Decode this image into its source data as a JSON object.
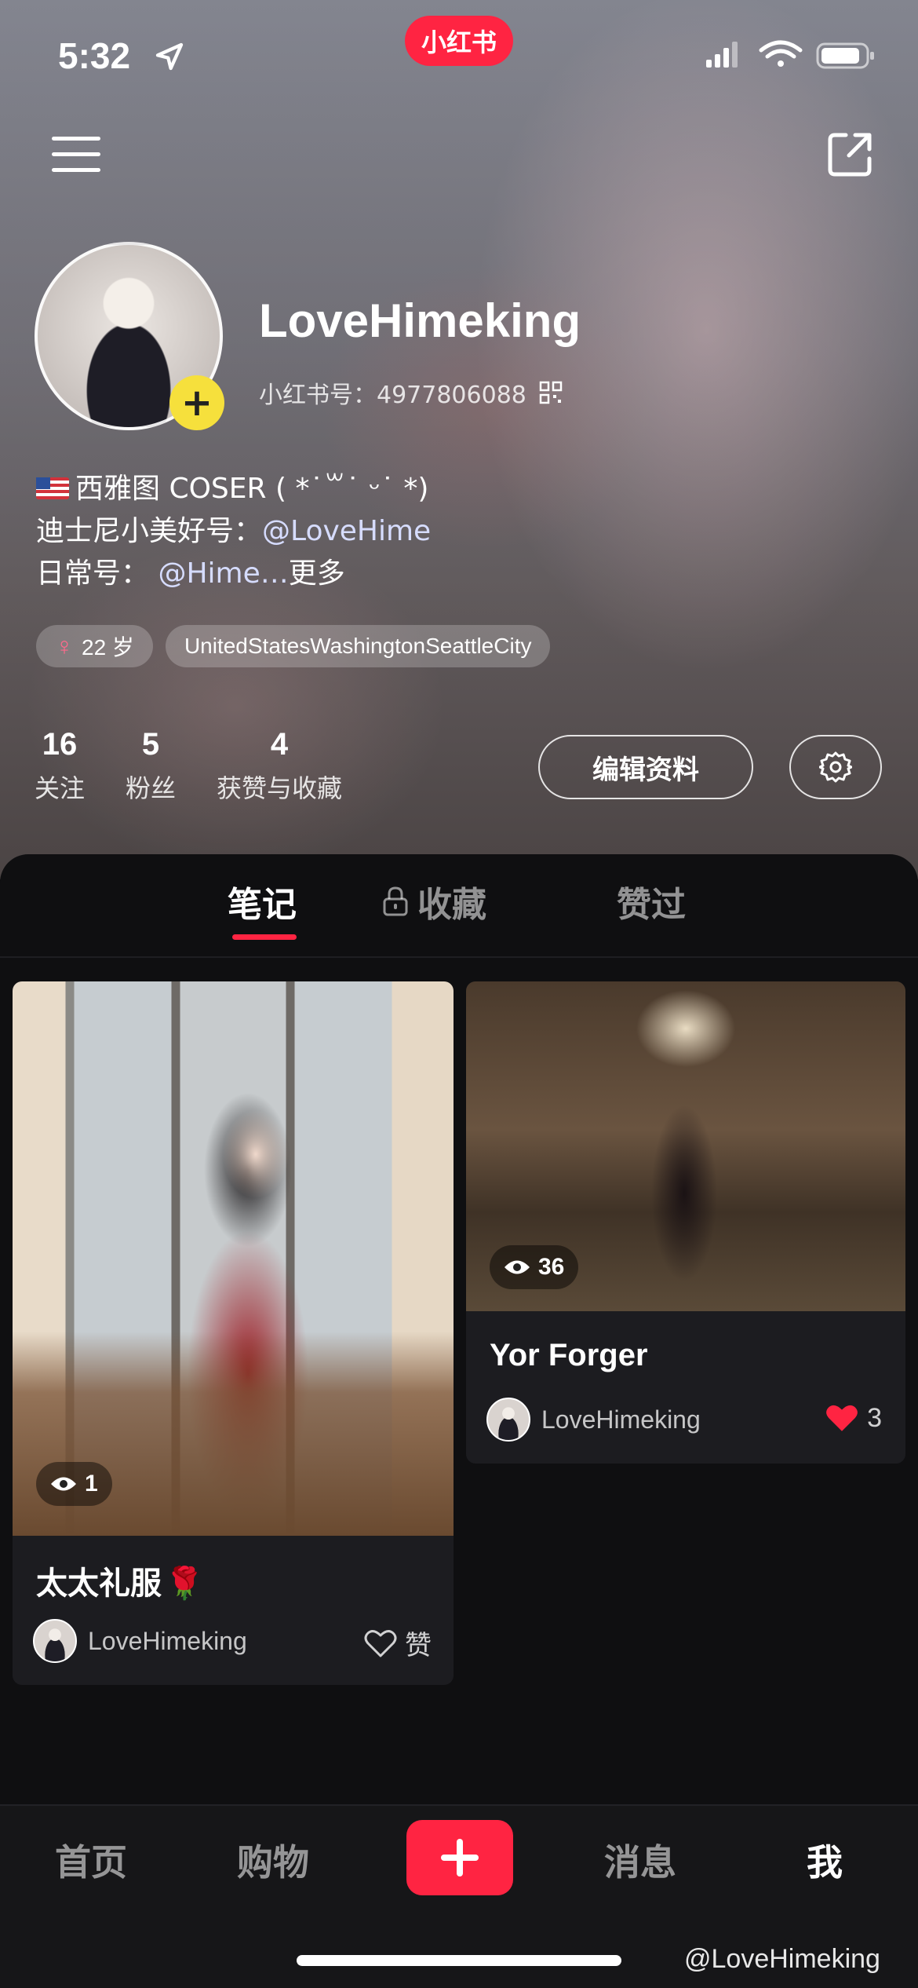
{
  "status_bar": {
    "time": "5:32",
    "app_badge": "小红书"
  },
  "profile": {
    "username": "LoveHimeking",
    "red_id_label": "小红书号：",
    "red_id": "4977806088",
    "bio": {
      "line1": "西雅图 COSER ( *˙꒳˙ ᵕ˙ *)",
      "line2_prefix": "迪士尼小美好号：",
      "line2_mention": "@LoveHime",
      "line3_prefix": "日常号：",
      "line3_mention": "@Hime…",
      "line3_more": "更多"
    },
    "tags": {
      "age": "22 岁",
      "location": "UnitedStatesWashingtonSeattleCity"
    },
    "stats": [
      {
        "value": "16",
        "label": "关注"
      },
      {
        "value": "5",
        "label": "粉丝"
      },
      {
        "value": "4",
        "label": "获赞与收藏"
      }
    ],
    "edit_button": "编辑资料"
  },
  "tabs": {
    "notes": "笔记",
    "collections": "收藏",
    "liked": "赞过"
  },
  "notes": [
    {
      "title": "太太礼服",
      "title_emoji": "🌹",
      "views": "1",
      "author": "LoveHimeking",
      "like_label": "赞",
      "liked": false
    },
    {
      "title": "Yor Forger",
      "views": "36",
      "author": "LoveHimeking",
      "like_label": "3",
      "liked": true
    }
  ],
  "bottom_nav": {
    "home": "首页",
    "shop": "购物",
    "messages": "消息",
    "me": "我"
  },
  "watermark": "@LoveHimeking",
  "colors": {
    "brand": "#ff2442",
    "avatar_badge": "#f6e03c"
  }
}
